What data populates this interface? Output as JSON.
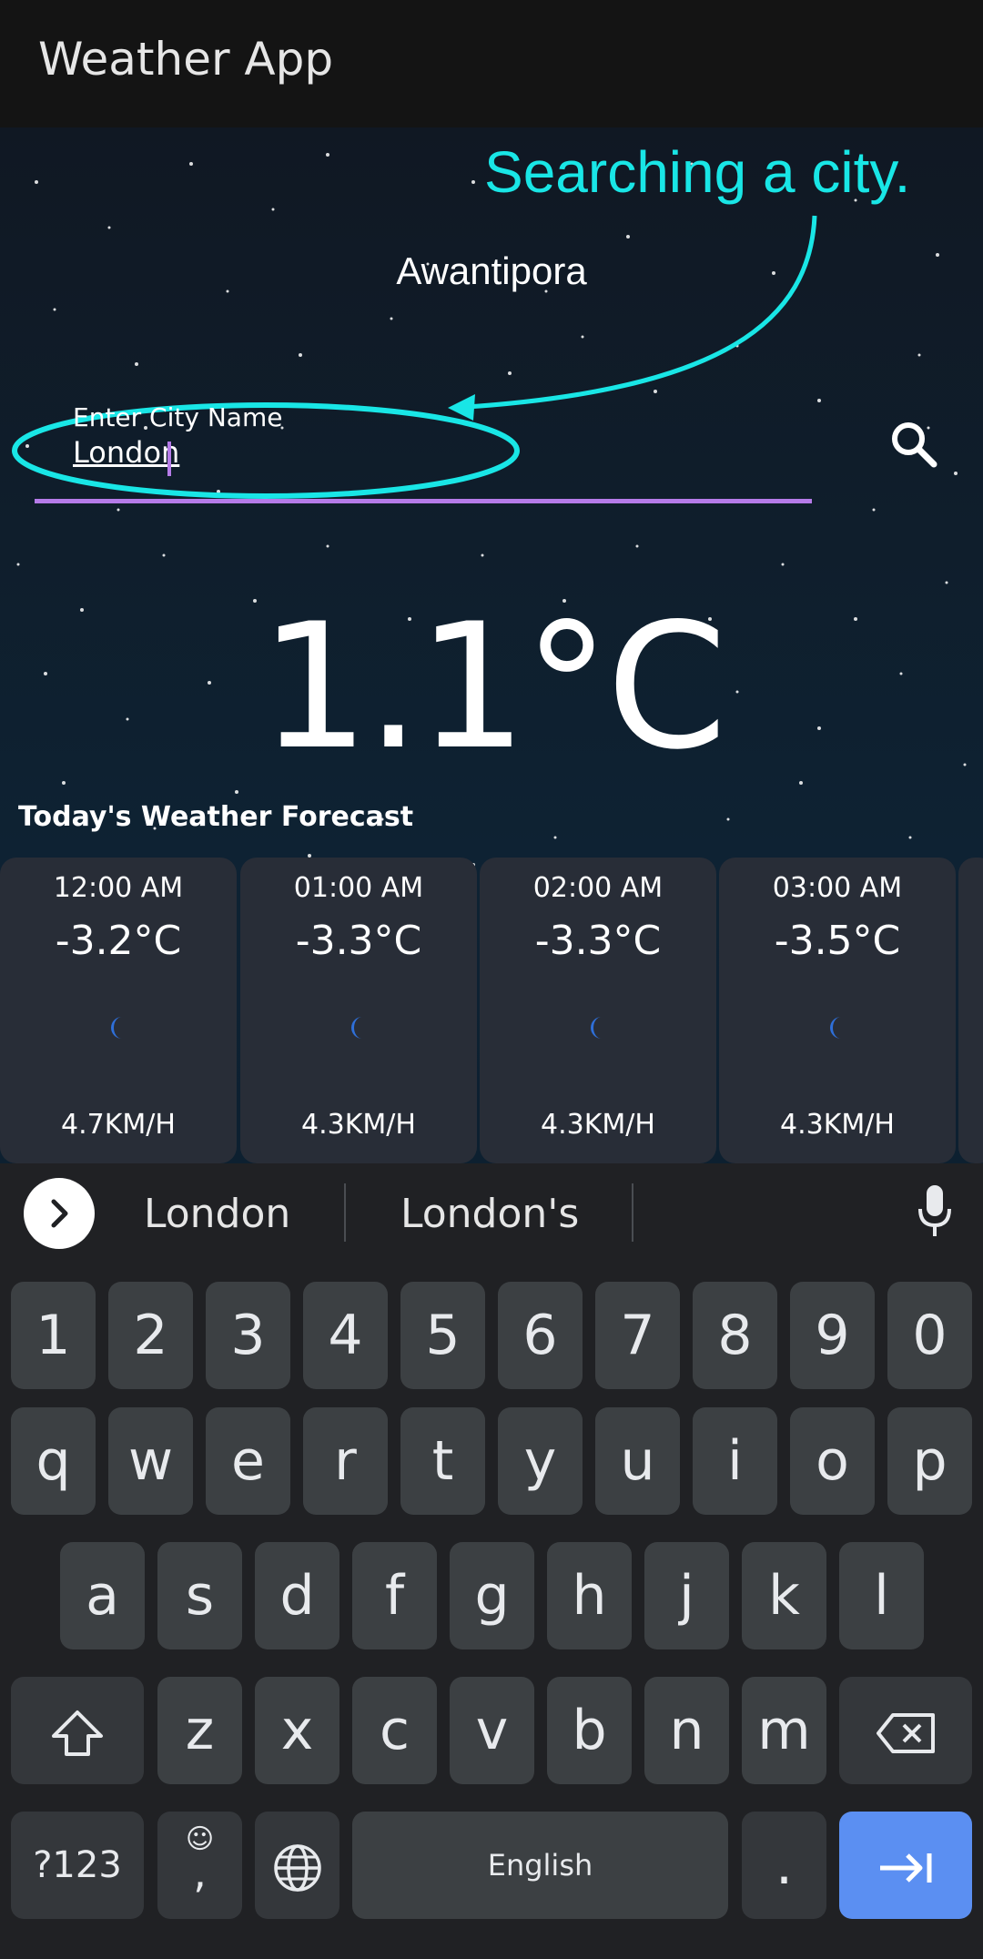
{
  "appbar": {
    "title": "Weather App"
  },
  "annotation": {
    "text": "Searching a city."
  },
  "location": {
    "city": "Awantipora"
  },
  "search": {
    "label": "Enter City Name",
    "value": "London"
  },
  "current": {
    "temperature": "1.1°C"
  },
  "forecast": {
    "title": "Today's Weather Forecast",
    "items": [
      {
        "time": "12:00 AM",
        "temp": "-3.2°C",
        "icon": "moon-icon",
        "wind": "4.7KM/H"
      },
      {
        "time": "01:00 AM",
        "temp": "-3.3°C",
        "icon": "moon-icon",
        "wind": "4.3KM/H"
      },
      {
        "time": "02:00 AM",
        "temp": "-3.3°C",
        "icon": "moon-icon",
        "wind": "4.3KM/H"
      },
      {
        "time": "03:00 AM",
        "temp": "-3.5°C",
        "icon": "moon-icon",
        "wind": "4.3KM/H"
      }
    ]
  },
  "keyboard": {
    "suggestions": [
      "London",
      "London's"
    ],
    "row_numbers": [
      "1",
      "2",
      "3",
      "4",
      "5",
      "6",
      "7",
      "8",
      "9",
      "0"
    ],
    "row_1": [
      "q",
      "w",
      "e",
      "r",
      "t",
      "y",
      "u",
      "i",
      "o",
      "p"
    ],
    "row_2": [
      "a",
      "s",
      "d",
      "f",
      "g",
      "h",
      "j",
      "k",
      "l"
    ],
    "row_3": [
      "z",
      "x",
      "c",
      "v",
      "b",
      "n",
      "m"
    ],
    "symbols_key": "?123",
    "comma_key": ",",
    "period_key": ".",
    "space_label": "English"
  },
  "colors": {
    "accent": "#b57be8",
    "annotation": "#19e6e6",
    "action_key": "#5b8ff2",
    "moon": "#2f6fd8"
  }
}
